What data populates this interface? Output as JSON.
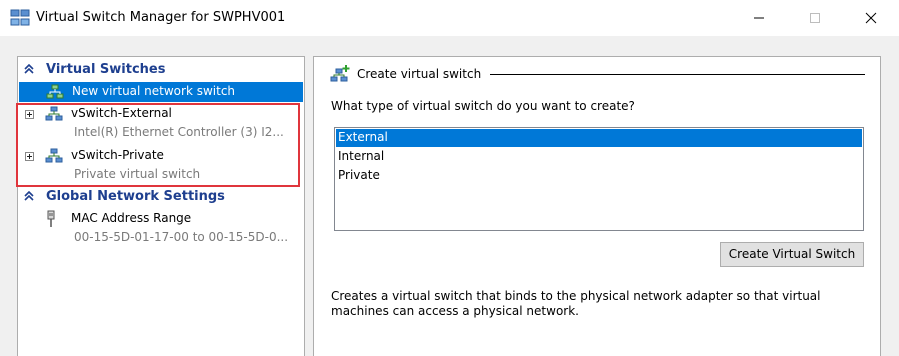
{
  "window": {
    "title": "Virtual Switch Manager for SWPHV001"
  },
  "left_pane": {
    "virtual_switches_header": "Virtual Switches",
    "new_switch_label": "New virtual network switch",
    "switches": [
      {
        "name": "vSwitch-External",
        "detail": "Intel(R) Ethernet Controller (3) I2..."
      },
      {
        "name": "vSwitch-Private",
        "detail": "Private virtual switch"
      }
    ],
    "global_header": "Global Network Settings",
    "mac_range": {
      "name": "MAC Address Range",
      "detail": "00-15-5D-01-17-00 to 00-15-5D-0..."
    }
  },
  "right_pane": {
    "group_title": "Create virtual switch",
    "question": "What type of virtual switch do you want to create?",
    "types": [
      "External",
      "Internal",
      "Private"
    ],
    "selected_type": "External",
    "create_button": "Create Virtual Switch",
    "description": "Creates a virtual switch that binds to the physical network adapter so that virtual machines can access a physical network."
  },
  "colors": {
    "selection": "#0078d7",
    "header_text": "#1e3f8f",
    "highlight_box": "#e0353c"
  },
  "icons": [
    "virtual-switch-manager-icon",
    "minimize-icon",
    "maximize-icon",
    "close-icon",
    "chevron-up-icon",
    "network-switch-icon",
    "expand-plus-icon",
    "nic-plug-icon",
    "add-switch-icon"
  ]
}
